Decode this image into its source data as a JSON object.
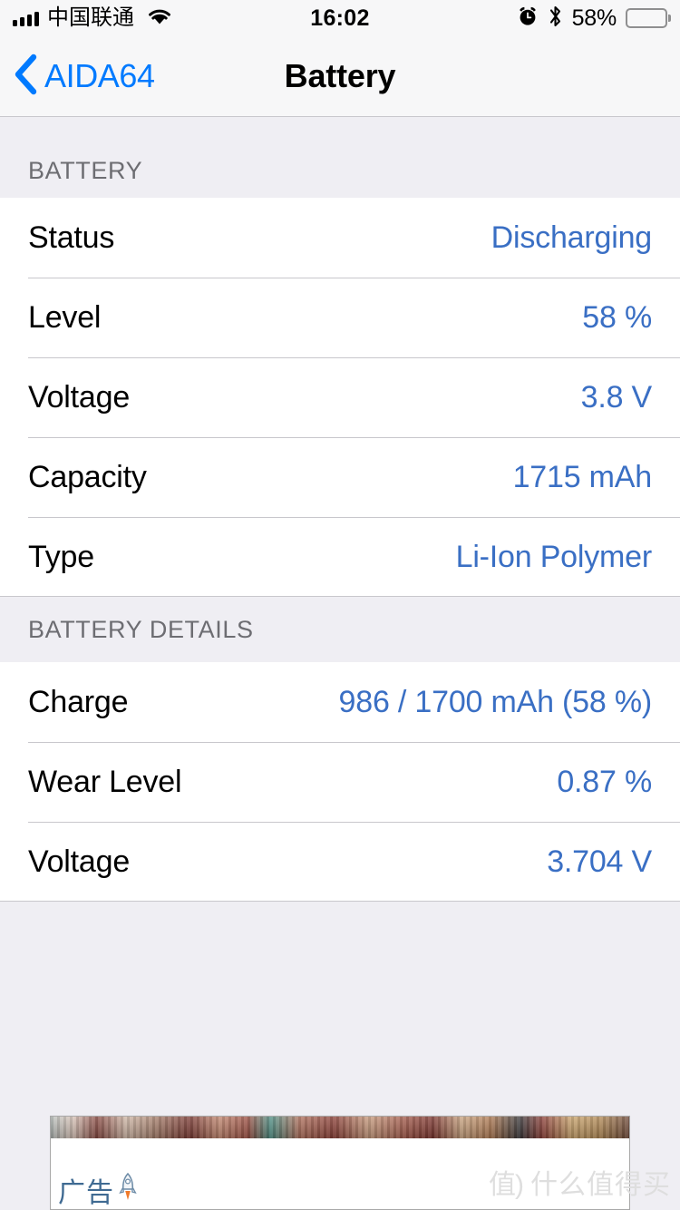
{
  "status_bar": {
    "carrier": "中国联通",
    "signal_icon": "signal-bars-icon",
    "wifi_icon": "wifi-icon",
    "time": "16:02",
    "alarm_icon": "alarm-clock-icon",
    "bluetooth_icon": "bluetooth-icon",
    "battery_percent": "58%",
    "battery_level": 58,
    "battery_icon": "battery-icon"
  },
  "nav_bar": {
    "back_icon": "chevron-left-icon",
    "back_label": "AIDA64",
    "title": "Battery"
  },
  "colors": {
    "accent_blue": "#007aff",
    "value_blue": "#3a6fc4",
    "header_gray": "#6d6d72",
    "group_bg": "#efeef3",
    "separator": "#c8c7cc"
  },
  "sections": [
    {
      "header": "BATTERY",
      "rows": [
        {
          "label": "Status",
          "value": "Discharging"
        },
        {
          "label": "Level",
          "value": "58 %"
        },
        {
          "label": "Voltage",
          "value": "3.8 V"
        },
        {
          "label": "Capacity",
          "value": "1715 mAh"
        },
        {
          "label": "Type",
          "value": "Li-Ion Polymer"
        }
      ]
    },
    {
      "header": "BATTERY DETAILS",
      "rows": [
        {
          "label": "Charge",
          "value": "986 / 1700 mAh (58 %)"
        },
        {
          "label": "Wear Level",
          "value": "0.87 %"
        },
        {
          "label": "Voltage",
          "value": "3.704 V"
        }
      ]
    }
  ],
  "ad": {
    "label": "广告",
    "rocket_icon": "rocket-icon",
    "watermark_seal": "值)",
    "watermark_text": "什么值得买"
  }
}
